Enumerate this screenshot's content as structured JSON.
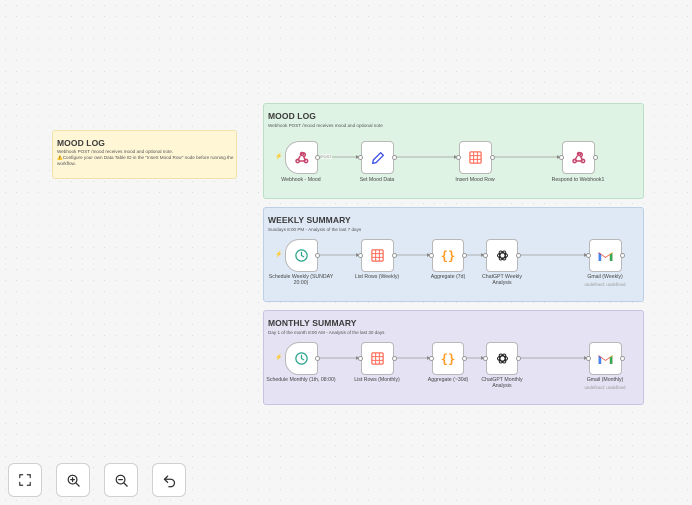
{
  "notes": {
    "left": {
      "title": "MOOD LOG",
      "line1": "Webhook POST /mood receives mood and optional note.",
      "line2": "⚠️Configure your own Data Table ID in the \"Insert Mood Row\" node before running the workflow."
    },
    "mood": {
      "title": "MOOD LOG",
      "subtitle": "Webhook POST /mood receives mood and optional note"
    },
    "weekly": {
      "title": "WEEKLY SUMMARY",
      "subtitle": "Sundays 8:00 PM - Analysis of the last 7 days"
    },
    "monthly": {
      "title": "MONTHLY SUMMARY",
      "subtitle": "Day 1 of the month 8:00 AM - Analysis of the last 30 days"
    }
  },
  "nodes": {
    "mood": {
      "webhook": "Webhook - Mood",
      "set": "Set Mood Data",
      "insert": "Insert Mood Row",
      "respond": "Respond to Webhook1",
      "edge_label": "POST"
    },
    "weekly": {
      "schedule": "Schedule Weekly (SUNDAY 20:00)",
      "list": "List Rows (Weekly)",
      "aggregate": "Aggregate (7d)",
      "chatgpt": "ChatGPT Weekly Analysis",
      "gmail": "Gmail (Weekly)",
      "gmail_sub": "undefined: undefined"
    },
    "monthly": {
      "schedule": "Schedule Monthly (1th, 08:00)",
      "list": "List Rows (Monthly)",
      "aggregate": "Aggregate (~30d)",
      "chatgpt": "ChatGPT Monthly Analysis",
      "gmail": "Gmail (Monthly)",
      "gmail_sub": "undefined: undefined"
    }
  },
  "controls": [
    "fit-view",
    "zoom-in",
    "zoom-out",
    "undo"
  ],
  "colors": {
    "mood_bg": "#dff3e4",
    "weekly_bg": "#dfe9f5",
    "monthly_bg": "#e4e2f3",
    "note_bg": "#fff5d6",
    "accent": "#ff6d5a",
    "table_red": "#ff6d5a",
    "schedule_teal": "#2ca58d",
    "aggregate_orange": "#ff9b26",
    "pencil_blue": "#3f51e5"
  }
}
